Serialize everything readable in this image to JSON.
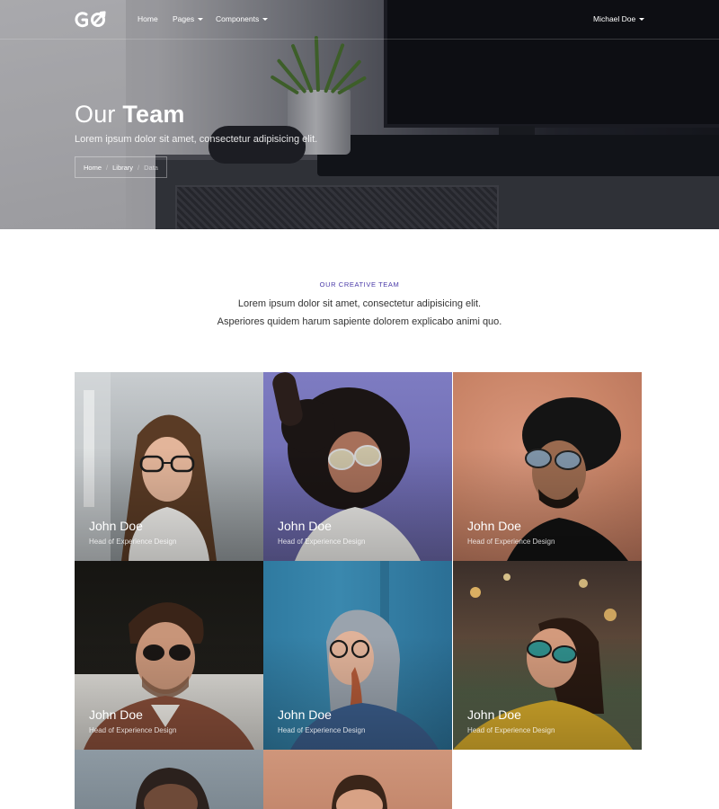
{
  "nav": {
    "logo_text": "GO",
    "links": [
      {
        "label": "Home",
        "has_caret": false
      },
      {
        "label": "Pages",
        "has_caret": true
      },
      {
        "label": "Components",
        "has_caret": true
      }
    ],
    "user": {
      "label": "Michael Doe",
      "has_caret": true
    }
  },
  "hero": {
    "title_light": "Our",
    "title_bold": "Team",
    "subtitle": "Lorem ipsum dolor sit amet, consectetur adipisicing elit.",
    "breadcrumb": [
      "Home",
      "Library",
      "Data"
    ]
  },
  "section": {
    "eyebrow": "OUR CREATIVE TEAM",
    "intro": "Lorem ipsum dolor sit amet, consectetur adipisicing elit. Asperiores quidem harum sapiente dolorem explicabo animi quo."
  },
  "team": [
    {
      "name": "John Doe",
      "role": "Head of Experience Design"
    },
    {
      "name": "John Doe",
      "role": "Head of Experience Design"
    },
    {
      "name": "John Doe",
      "role": "Head of Experience Design"
    },
    {
      "name": "John Doe",
      "role": "Head of Experience Design"
    },
    {
      "name": "John Doe",
      "role": "Head of Experience Design"
    },
    {
      "name": "John Doe",
      "role": "Head of Experience Design"
    },
    {
      "name": "",
      "role": ""
    },
    {
      "name": "",
      "role": ""
    }
  ],
  "colors": {
    "accent": "#4a3aa8",
    "text": "#333333",
    "hero_text": "#ffffff"
  }
}
